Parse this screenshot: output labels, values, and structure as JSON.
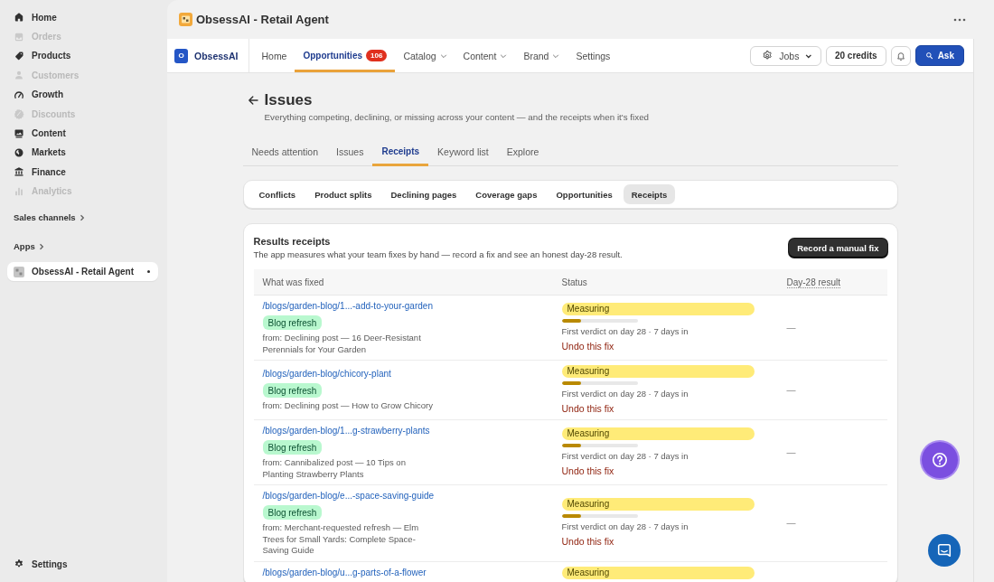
{
  "sidebar": {
    "items": [
      {
        "label": "Home",
        "disabled": false,
        "selected": false
      },
      {
        "label": "Orders",
        "disabled": true,
        "selected": false
      },
      {
        "label": "Products",
        "disabled": false,
        "selected": false
      },
      {
        "label": "Customers",
        "disabled": true,
        "selected": false
      },
      {
        "label": "Growth",
        "disabled": false,
        "selected": false
      },
      {
        "label": "Discounts",
        "disabled": true,
        "selected": false
      },
      {
        "label": "Content",
        "disabled": false,
        "selected": false
      },
      {
        "label": "Markets",
        "disabled": false,
        "selected": false
      },
      {
        "label": "Finance",
        "disabled": false,
        "selected": false
      },
      {
        "label": "Analytics",
        "disabled": true,
        "selected": false
      }
    ],
    "sales_channels": "Sales channels",
    "apps_heading": "Apps",
    "apps": [
      {
        "label": "ObsessAI - Retail Agent",
        "selected": true
      }
    ],
    "settings": "Settings"
  },
  "header": {
    "title": "ObsessAI - Retail Agent"
  },
  "app_nav": {
    "brand_initial": "O",
    "brand_name": "ObsessAI",
    "items": [
      {
        "label": "Home",
        "selected": false,
        "dropdown": false
      },
      {
        "label": "Opportunities",
        "selected": true,
        "dropdown": false,
        "badge": "106"
      },
      {
        "label": "Catalog",
        "selected": false,
        "dropdown": true
      },
      {
        "label": "Content",
        "selected": false,
        "dropdown": true
      },
      {
        "label": "Brand",
        "selected": false,
        "dropdown": true
      },
      {
        "label": "Settings",
        "selected": false,
        "dropdown": false
      }
    ],
    "jobs": "Jobs",
    "credits": "20 credits",
    "ask": "Ask"
  },
  "page": {
    "title": "Issues",
    "subtitle": "Everything competing, declining, or missing across your content — and the receipts when it's fixed",
    "tabs": [
      {
        "label": "Needs attention",
        "selected": false
      },
      {
        "label": "Issues",
        "selected": false
      },
      {
        "label": "Receipts",
        "selected": true
      },
      {
        "label": "Keyword list",
        "selected": false
      },
      {
        "label": "Explore",
        "selected": false
      }
    ],
    "subtabs": [
      {
        "label": "Conflicts",
        "selected": false
      },
      {
        "label": "Product splits",
        "selected": false
      },
      {
        "label": "Declining pages",
        "selected": false
      },
      {
        "label": "Coverage gaps",
        "selected": false
      },
      {
        "label": "Opportunities",
        "selected": false
      },
      {
        "label": "Receipts",
        "selected": true
      }
    ]
  },
  "receipts": {
    "title": "Results receipts",
    "description": "The app measures what your team fixes by hand — record a fix and see an honest day-28 result.",
    "action": "Record a manual fix",
    "columns": [
      "What was fixed",
      "Status",
      "Day-28 result"
    ],
    "rows": [
      {
        "link": "/blogs/garden-blog/1...-add-to-your-garden",
        "tag": "Blog refresh",
        "source": "from: Declining post — 16 Deer-Resistant Perennials for Your Garden",
        "status": "Measuring",
        "level": 0.25,
        "verdict": "First verdict on day 28 · 7 days in",
        "undo": "Undo this fix",
        "result": "—"
      },
      {
        "link": "/blogs/garden-blog/chicory-plant",
        "tag": "Blog refresh",
        "source": "from: Declining post — How to Grow Chicory",
        "status": "Measuring",
        "level": 0.25,
        "verdict": "First verdict on day 28 · 7 days in",
        "undo": "Undo this fix",
        "result": "—"
      },
      {
        "link": "/blogs/garden-blog/1...g-strawberry-plants",
        "tag": "Blog refresh",
        "source": "from: Cannibalized post — 10 Tips on Planting Strawberry Plants",
        "status": "Measuring",
        "level": 0.25,
        "verdict": "First verdict on day 28 · 7 days in",
        "undo": "Undo this fix",
        "result": "—"
      },
      {
        "link": "/blogs/garden-blog/e...-space-saving-guide",
        "tag": "Blog refresh",
        "source": "from: Merchant-requested refresh — Elm Trees for Small Yards: Complete Space-Saving Guide",
        "status": "Measuring",
        "level": 0.25,
        "verdict": "First verdict on day 28 · 7 days in",
        "undo": "Undo this fix",
        "result": "—"
      },
      {
        "link": "/blogs/garden-blog/u...g-parts-of-a-flower",
        "status": "Measuring"
      }
    ]
  }
}
